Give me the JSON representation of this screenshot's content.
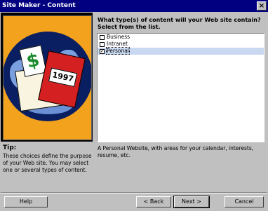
{
  "window": {
    "title": "Site Maker - Content",
    "close_label": "×"
  },
  "illustration": {
    "book_label": "1997",
    "card_symbol": "$"
  },
  "tip": {
    "heading": "Tip:",
    "text": "These choices define the purpose of your Web site. You may select one or several types of content."
  },
  "question": "What type(s) of content will your Web site contain? Select from the list.",
  "content_types": [
    {
      "label": "Business",
      "checked": false,
      "selected": false
    },
    {
      "label": "Intranet",
      "checked": false,
      "selected": false
    },
    {
      "label": "Personal",
      "checked": true,
      "selected": true
    }
  ],
  "description": "A Personal Website, with areas for your calendar, interests, resume, etc.",
  "buttons": {
    "help": "Help",
    "back": "< Back",
    "next": "Next >",
    "cancel": "Cancel"
  }
}
